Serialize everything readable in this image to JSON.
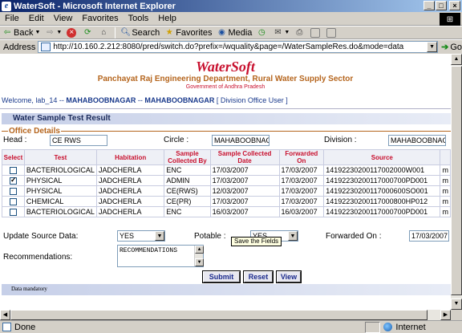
{
  "window": {
    "title": "WaterSoft - Microsoft Internet Explorer",
    "controls": [
      "_",
      "□",
      "×"
    ]
  },
  "menu": [
    "File",
    "Edit",
    "View",
    "Favorites",
    "Tools",
    "Help"
  ],
  "toolbar": {
    "back": "Back",
    "search": "Search",
    "favorites": "Favorites",
    "media": "Media"
  },
  "address": {
    "label": "Address",
    "url": "http://10.160.2.212:8080/pred/switch.do?prefix=/wquality&page=/WaterSampleRes.do&mode=data",
    "go": "Go"
  },
  "header": {
    "logo": "WaterSoft",
    "department": "Panchayat Raj Engineering Department, Rural Water Supply Sector",
    "government": "Government of Andhra Pradesh",
    "welcome_prefix": "Welcome, lab_14 -- ",
    "welcome_district": "MAHABOOBNAGAR",
    "welcome_sep": " -- ",
    "welcome_division": "MAHABOOBNAGAR",
    "welcome_role": " [ Division Office User ]"
  },
  "section": {
    "title": "Water Sample Test Result",
    "office_details": "Office Details",
    "head_label": "Head :",
    "head_value": "CE RWS",
    "circle_label": "Circle :",
    "circle_value": "MAHABOOBNAGAR",
    "division_label": "Division :",
    "division_value": "MAHABOOBNAGAR"
  },
  "table": {
    "headers": [
      "Select",
      "Test",
      "Habitation",
      "Sample Collected By",
      "Sample Collected Date",
      "Forwarded On",
      "Source",
      ""
    ],
    "rows": [
      {
        "checked": false,
        "test": "BACTERIOLOGICAL",
        "habitation": "JADCHERLA",
        "collected_by": "ENC",
        "collected_date": "17/03/2007",
        "forwarded_on": "17/03/2007",
        "source": "14192230200117002000W001",
        "extra": "m"
      },
      {
        "checked": true,
        "test": "PHYSICAL",
        "habitation": "JADCHERLA",
        "collected_by": "ADMIN",
        "collected_date": "17/03/2007",
        "forwarded_on": "17/03/2007",
        "source": "14192230200117000700PD001",
        "extra": "m"
      },
      {
        "checked": false,
        "test": "PHYSICAL",
        "habitation": "JADCHERLA",
        "collected_by": "CE(RWS)",
        "collected_date": "12/03/2007",
        "forwarded_on": "17/03/2007",
        "source": "14192230200117000600SO001",
        "extra": "m"
      },
      {
        "checked": false,
        "test": "CHEMICAL",
        "habitation": "JADCHERLA",
        "collected_by": "CE(PR)",
        "collected_date": "17/03/2007",
        "forwarded_on": "17/03/2007",
        "source": "14192230200117000800HP012",
        "extra": "m"
      },
      {
        "checked": false,
        "test": "BACTERIOLOGICAL",
        "habitation": "JADCHERLA",
        "collected_by": "ENC",
        "collected_date": "16/03/2007",
        "forwarded_on": "16/03/2007",
        "source": "14192230200117000700PD001",
        "extra": "m"
      }
    ]
  },
  "form": {
    "update_label": "Update Source Data:",
    "update_value": "YES",
    "potable_label": "Potable :",
    "potable_value": "YES",
    "forwarded_label": "Forwarded On :",
    "forwarded_value": "17/03/2007",
    "recommendations_label": "Recommendations:",
    "recommendations_value": "RECOMMENDATIONS"
  },
  "buttons": {
    "submit": "Submit",
    "reset": "Reset",
    "view": "View"
  },
  "tooltip": "Save the Fields",
  "footer_note": "Data mandatory",
  "status": {
    "left": "Done",
    "zone": "Internet"
  }
}
